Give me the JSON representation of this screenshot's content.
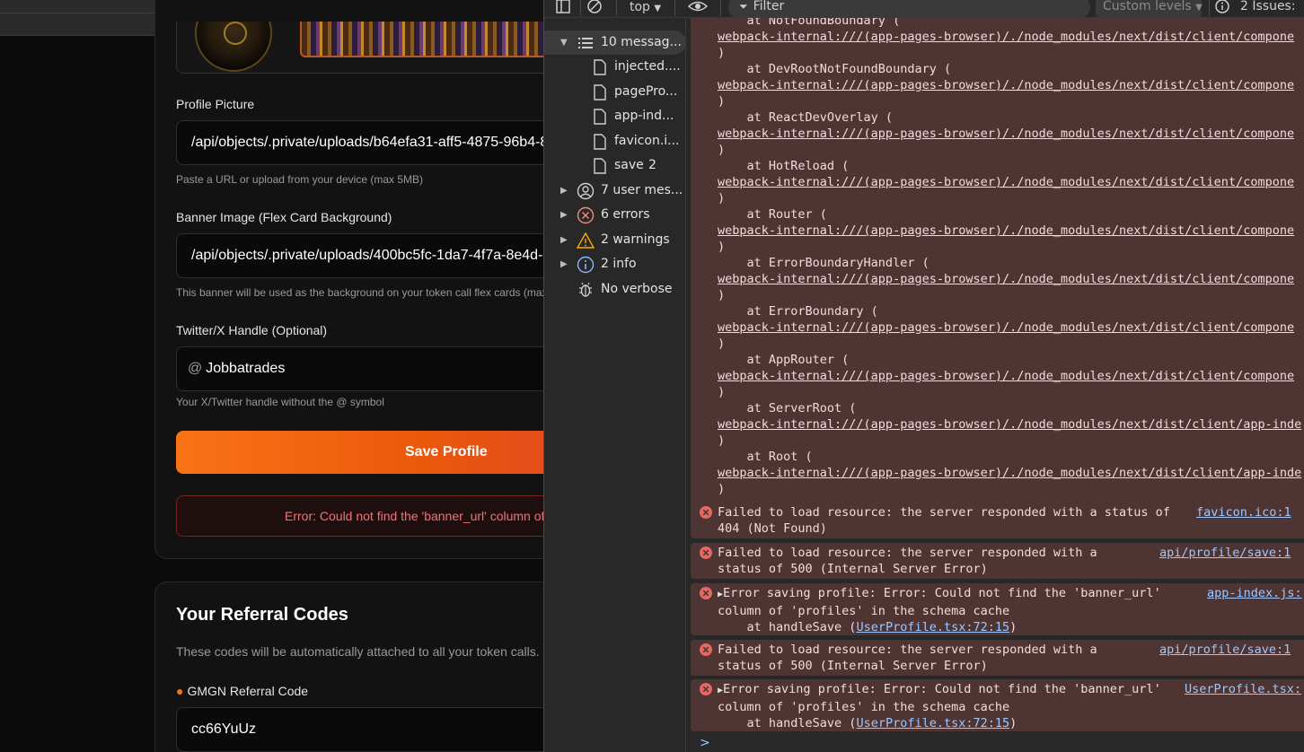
{
  "app": {
    "profile_picture": {
      "label": "Profile Picture",
      "value": "/api/objects/.private/uploads/b64efa31-aff5-4875-96b4-8",
      "help": "Paste a URL or upload from your device (max 5MB)"
    },
    "banner_image": {
      "label": "Banner Image (Flex Card Background)",
      "value": "/api/objects/.private/uploads/400bc5fc-1da7-4f7a-8e4d-",
      "help": "This banner will be used as the background on your token call flex cards (max"
    },
    "twitter": {
      "label": "Twitter/X Handle (Optional)",
      "prefix": "@",
      "value": "Jobbatrades",
      "help": "Your X/Twitter handle without the @ symbol"
    },
    "save_button": "Save Profile",
    "error_message": "Error: Could not find the 'banner_url' column of",
    "referral": {
      "title": "Your Referral Codes",
      "description": "These codes will be automatically attached to all your token calls.",
      "gmgn_label": "GMGN Referral Code",
      "gmgn_value": "cc66YuUz"
    }
  },
  "devtools": {
    "toolbar": {
      "context": "top",
      "filter_placeholder": "Filter",
      "levels": "Custom levels",
      "issues": "2 Issues:"
    },
    "sidebar": {
      "messages": "10 messag...",
      "files": [
        {
          "name": "injected....",
          "count": ""
        },
        {
          "name": "pagePro...",
          "count": ""
        },
        {
          "name": "app-ind...",
          "count": ""
        },
        {
          "name": "favicon.i...",
          "count": ""
        },
        {
          "name": "save",
          "count": "2"
        }
      ],
      "user_messages": "7 user mes...",
      "errors": "6 errors",
      "warnings": "2 warnings",
      "info": "2 info",
      "verbose": "No verbose"
    },
    "stack": {
      "top_fragment": "    at NotFoundBoundary (",
      "frames": [
        {
          "at": "",
          "link": "webpack-internal:///(app-pages-browser)/./node_modules/next/dist/client/compone"
        },
        {
          "at": "    at DevRootNotFoundBoundary (",
          "link": "webpack-internal:///(app-pages-browser)/./node_modules/next/dist/client/compone"
        },
        {
          "at": "    at ReactDevOverlay (",
          "link": "webpack-internal:///(app-pages-browser)/./node_modules/next/dist/client/compone"
        },
        {
          "at": "    at HotReload (",
          "link": "webpack-internal:///(app-pages-browser)/./node_modules/next/dist/client/compone"
        },
        {
          "at": "    at Router (",
          "link": "webpack-internal:///(app-pages-browser)/./node_modules/next/dist/client/compone"
        },
        {
          "at": "    at ErrorBoundaryHandler (",
          "link": "webpack-internal:///(app-pages-browser)/./node_modules/next/dist/client/compone"
        },
        {
          "at": "    at ErrorBoundary (",
          "link": "webpack-internal:///(app-pages-browser)/./node_modules/next/dist/client/compone"
        },
        {
          "at": "    at AppRouter (",
          "link": "webpack-internal:///(app-pages-browser)/./node_modules/next/dist/client/compone"
        },
        {
          "at": "    at ServerRoot (",
          "link": "webpack-internal:///(app-pages-browser)/./node_modules/next/dist/client/app-inde"
        },
        {
          "at": "    at Root (",
          "link": "webpack-internal:///(app-pages-browser)/./node_modules/next/dist/client/app-inde"
        }
      ],
      "close_paren": ")"
    },
    "messages": [
      {
        "line1": "Failed to load resource: the server responded with a status of",
        "line2": "404 (Not Found)",
        "line3": "",
        "line3_link": "",
        "line3_end": "",
        "source": "favicon.ico:1",
        "expandable": false
      },
      {
        "line1": "Failed to load resource: the server responded with a",
        "line2": "status of 500 (Internal Server Error)",
        "line3": "",
        "line3_link": "",
        "line3_end": "",
        "source": "api/profile/save:1",
        "expandable": false
      },
      {
        "line1": "Error saving profile: Error: Could not find the 'banner_url'",
        "line2": "column of 'profiles' in the schema cache",
        "line3": "    at handleSave (",
        "line3_link": "UserProfile.tsx:72:15",
        "line3_end": ")",
        "source": "app-index.js:",
        "expandable": true
      },
      {
        "line1": "Failed to load resource: the server responded with a",
        "line2": "status of 500 (Internal Server Error)",
        "line3": "",
        "line3_link": "",
        "line3_end": "",
        "source": "api/profile/save:1",
        "expandable": false
      },
      {
        "line1": "Error saving profile: Error: Could not find the 'banner_url'",
        "line2": "column of 'profiles' in the schema cache",
        "line3": "    at handleSave (",
        "line3_link": "UserProfile.tsx:72:15",
        "line3_end": ")",
        "source": "UserProfile.tsx:",
        "expandable": true
      }
    ],
    "prompt_symbol": ">"
  },
  "colors": {
    "accent": "#f97316",
    "error_red": "#f87171",
    "devtools_error_bg": "#4e3534",
    "link_blue": "#9ec7ff"
  }
}
